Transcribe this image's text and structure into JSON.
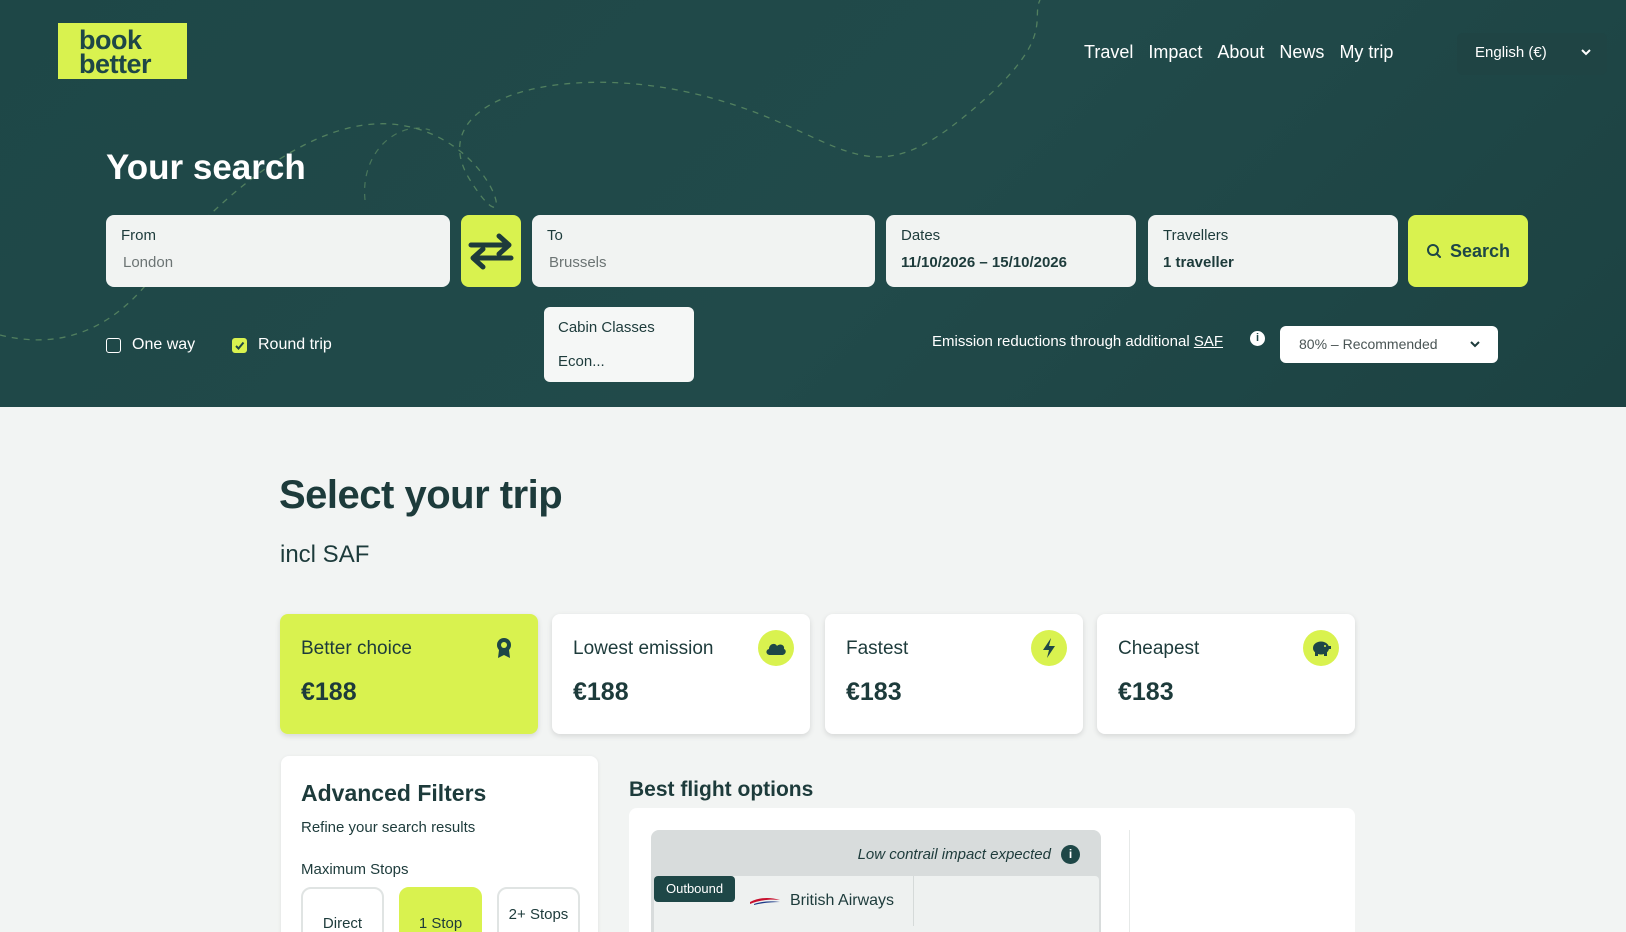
{
  "brand": {
    "logo_line1": "book",
    "logo_line2": "better",
    "accent": "#d9f24f",
    "dark": "#1e4747"
  },
  "nav": {
    "items": [
      "Travel",
      "Impact",
      "About",
      "News",
      "My trip"
    ],
    "language": "English (€)"
  },
  "search": {
    "title": "Your search",
    "from": {
      "label": "From",
      "value": "London"
    },
    "to": {
      "label": "To",
      "value": "Brussels"
    },
    "dates": {
      "label": "Dates",
      "value": "11/10/2026 – 15/10/2026"
    },
    "travellers": {
      "label": "Travellers",
      "value": "1 traveller"
    },
    "button": "Search",
    "one_way": {
      "label": "One way",
      "checked": false
    },
    "round_trip": {
      "label": "Round trip",
      "checked": true
    },
    "cabin": {
      "label": "Cabin Classes",
      "value": "Econ..."
    },
    "saf": {
      "text": "Emission reductions through additional ",
      "link": "SAF",
      "selected": "80% – Recommended"
    }
  },
  "main": {
    "title": "Select your trip",
    "subtitle": "incl SAF",
    "cards": [
      {
        "label": "Better choice",
        "price": "€188",
        "icon": "award-icon",
        "active": true
      },
      {
        "label": "Lowest emission",
        "price": "€188",
        "icon": "cloud-icon",
        "active": false
      },
      {
        "label": "Fastest",
        "price": "€183",
        "icon": "lightning-icon",
        "active": false
      },
      {
        "label": "Cheapest",
        "price": "€183",
        "icon": "piggy-bank-icon",
        "active": false
      }
    ],
    "filters": {
      "title": "Advanced Filters",
      "subtitle": "Refine your search results",
      "max_stops_label": "Maximum Stops",
      "stops": [
        "Direct",
        "1 Stop",
        "2+ Stops"
      ],
      "selected_stop": "1 Stop"
    },
    "best": {
      "title": "Best flight options",
      "contrail": "Low contrail impact expected",
      "direction": "Outbound",
      "airline": "British Airways"
    }
  }
}
